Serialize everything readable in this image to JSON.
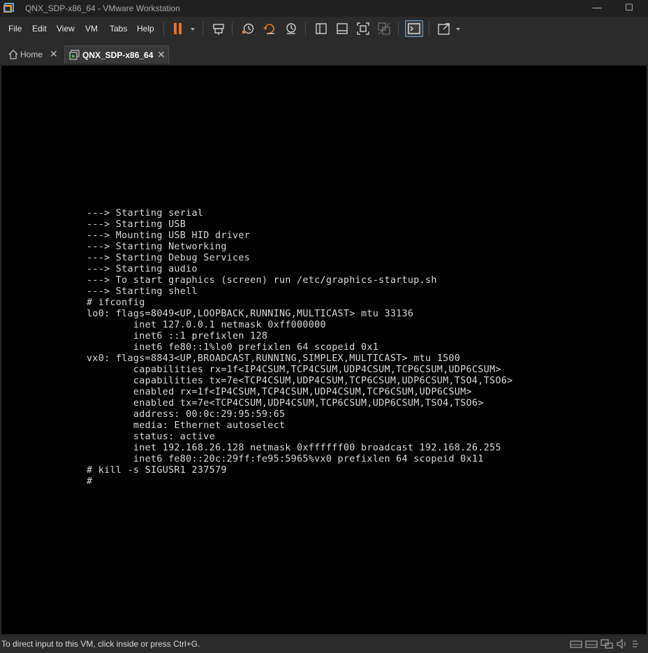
{
  "window": {
    "title": "QNX_SDP-x86_64 - VMware Workstation",
    "minimize_glyph": "—",
    "maximize_glyph": "☐",
    "icon": "vmware-logo-icon"
  },
  "menu": {
    "items": [
      "File",
      "Edit",
      "View",
      "VM",
      "Tabs",
      "Help"
    ]
  },
  "toolbar": {
    "icons": [
      "pause-icon",
      "dropdown-icon",
      "send-ctrl-alt-del-icon",
      "snapshot-icon",
      "revert-snapshot-icon",
      "snapshot-manager-icon",
      "library-icon",
      "thumbnail-icon",
      "full-screen-icon",
      "unity-icon",
      "console-view-icon",
      "stretch-icon",
      "dropdown-icon"
    ],
    "colors": {
      "pause": "#e8742a",
      "active_border": "#6aa2d8"
    }
  },
  "tabs": [
    {
      "label": "Home",
      "close": "✕",
      "icon": "home-icon"
    },
    {
      "label": "QNX_SDP-x86_64",
      "close": "✕",
      "icon": "vm-icon",
      "active": true
    }
  ],
  "console": {
    "lines": [
      "---> Starting serial",
      "---> Starting USB",
      "---> Mounting USB HID driver",
      "---> Starting Networking",
      "---> Starting Debug Services",
      "---> Starting audio",
      "---> To start graphics (screen) run /etc/graphics-startup.sh",
      "---> Starting shell",
      "# ifconfig",
      "lo0: flags=8049<UP,LOOPBACK,RUNNING,MULTICAST> mtu 33136",
      "        inet 127.0.0.1 netmask 0xff000000",
      "        inet6 ::1 prefixlen 128",
      "        inet6 fe80::1%lo0 prefixlen 64 scopeid 0x1",
      "vx0: flags=8843<UP,BROADCAST,RUNNING,SIMPLEX,MULTICAST> mtu 1500",
      "        capabilities rx=1f<IP4CSUM,TCP4CSUM,UDP4CSUM,TCP6CSUM,UDP6CSUM>",
      "        capabilities tx=7e<TCP4CSUM,UDP4CSUM,TCP6CSUM,UDP6CSUM,TSO4,TSO6>",
      "        enabled rx=1f<IP4CSUM,TCP4CSUM,UDP4CSUM,TCP6CSUM,UDP6CSUM>",
      "        enabled tx=7e<TCP4CSUM,UDP4CSUM,TCP6CSUM,UDP6CSUM,TSO4,TSO6>",
      "        address: 00:0c:29:95:59:65",
      "        media: Ethernet autoselect",
      "        status: active",
      "        inet 192.168.26.128 netmask 0xffffff00 broadcast 192.168.26.255",
      "        inet6 fe80::20c:29ff:fe95:5965%vx0 prefixlen 64 scopeid 0x11",
      "# kill -s SIGUSR1 237579",
      "#"
    ]
  },
  "status": {
    "message": "To direct input to this VM, click inside or press Ctrl+G.",
    "icons": [
      "hard-disk-icon",
      "hard-disk-icon",
      "network-adapter-icon",
      "sound-card-icon",
      "display-icon"
    ]
  }
}
